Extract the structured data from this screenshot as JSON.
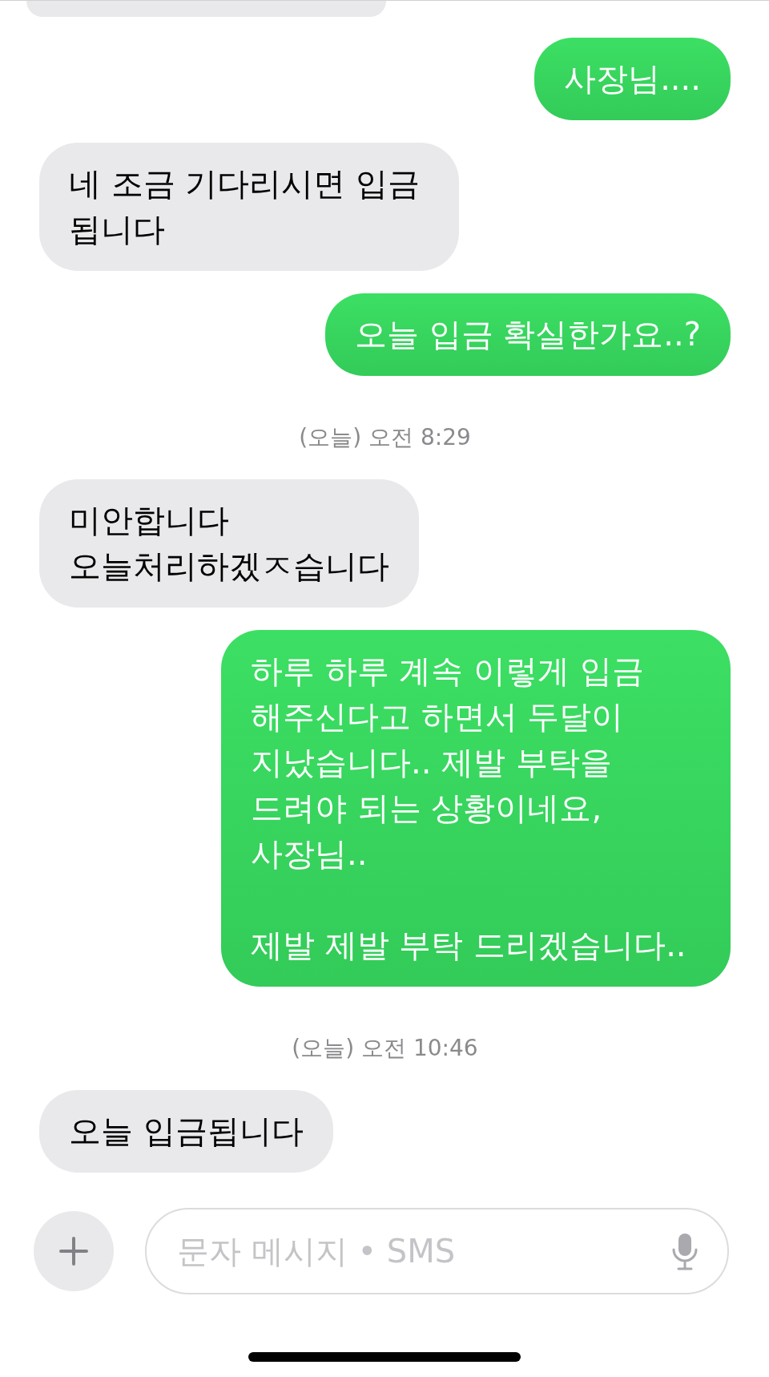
{
  "messages": [
    {
      "kind": "cutoff",
      "outgoing": false
    },
    {
      "kind": "bubble",
      "outgoing": true,
      "text": "사장님...."
    },
    {
      "kind": "bubble",
      "outgoing": false,
      "text": "네 조금 기다리시면 입금 됩니다"
    },
    {
      "kind": "bubble",
      "outgoing": true,
      "text": "오늘 입금 확실한가요..?"
    },
    {
      "kind": "time",
      "text": "(오늘) 오전 8:29"
    },
    {
      "kind": "bubble",
      "outgoing": false,
      "text": "미안합니다\n오늘처리하겠ㅈ습니다"
    },
    {
      "kind": "bubble",
      "outgoing": true,
      "text": "하루 하루 계속 이렇게 입금 해주신다고 하면서 두달이 지났습니다.. 제발 부탁을 드려야 되는 상황이네요, 사장님..\n\n제발 제발 부탁 드리겠습니다.."
    },
    {
      "kind": "time",
      "text": "(오늘) 오전 10:46"
    },
    {
      "kind": "bubble",
      "outgoing": false,
      "text": "오늘 입금됩니다"
    }
  ],
  "composer": {
    "placeholder": "문자 메시지 • SMS"
  }
}
